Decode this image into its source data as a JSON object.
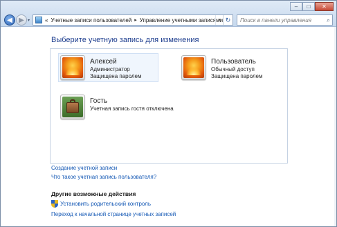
{
  "window": {
    "controls": {
      "minimize": "–",
      "maximize": "□",
      "close": "✕"
    }
  },
  "nav": {
    "back_icon": "◀",
    "forward_icon": "▶",
    "dropdown_icon": "▾"
  },
  "address": {
    "lead": "«",
    "crumbs": [
      "Учетные записи пользователей",
      "Управление учетными записями"
    ],
    "separator": "▸",
    "chevron": "▾",
    "refresh": "↻"
  },
  "search": {
    "placeholder": "Поиск в панели управления",
    "icon": "⌕"
  },
  "main": {
    "heading": "Выберите учетную запись для изменения",
    "accounts": [
      {
        "name": "Алексей",
        "line1": "Администратор",
        "line2": "Защищена паролем",
        "picture": "flower"
      },
      {
        "name": "Пользователь",
        "line1": "Обычный доступ",
        "line2": "Защищена паролем",
        "picture": "flower"
      },
      {
        "name": "Гость",
        "line1": "Учетная запись гостя отключена",
        "line2": "",
        "picture": "briefcase"
      }
    ],
    "links": [
      "Создание учетной записи",
      "Что такое учетная запись пользователя?"
    ],
    "other_title": "Другие возможные действия",
    "parental_link": "Установить родительский контроль",
    "home_link": "Переход к начальной странице учетных записей"
  },
  "colors": {
    "link": "#1559b5",
    "heading": "#1e3e8f",
    "panel_border": "#c5d2e3",
    "hover_bg": "#f0f6fd"
  }
}
